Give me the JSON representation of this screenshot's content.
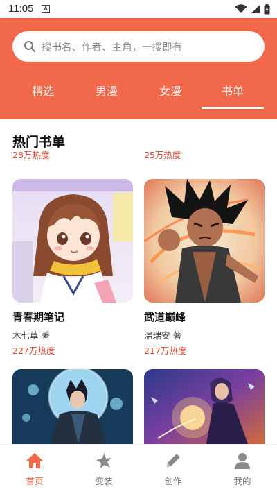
{
  "status": {
    "time": "11:05",
    "notif_letter": "A"
  },
  "search": {
    "placeholder": "搜书名、作者、主角，一搜即有"
  },
  "tabs": [
    {
      "label": "精选"
    },
    {
      "label": "男漫"
    },
    {
      "label": "女漫"
    },
    {
      "label": "书单",
      "active": true
    }
  ],
  "section": {
    "title": "热门书单"
  },
  "top_partial": [
    {
      "hot": "28万热度"
    },
    {
      "hot": "25万热度"
    }
  ],
  "books": [
    {
      "title": "青春期笔记",
      "author": "木七草 著",
      "hot": "227万热度"
    },
    {
      "title": "武道巅峰",
      "author": "温瑞安 著",
      "hot": "217万热度"
    }
  ],
  "bottom_nav": [
    {
      "label": "首页",
      "icon": "home-icon",
      "active": true
    },
    {
      "label": "变装",
      "icon": "star-icon"
    },
    {
      "label": "创作",
      "icon": "pencil-icon"
    },
    {
      "label": "我的",
      "icon": "user-icon"
    }
  ],
  "colors": {
    "accent": "#f1694a",
    "hot_text": "#e04b3c"
  }
}
